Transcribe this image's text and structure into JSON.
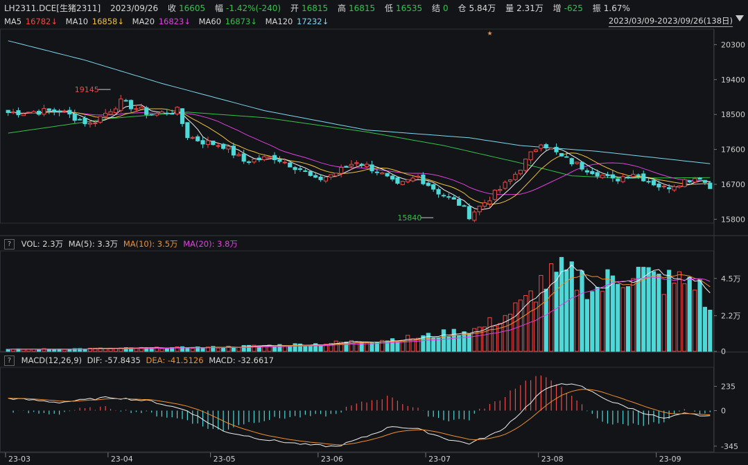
{
  "header": {
    "symbol": "LH2311.DCE[生猪2311]",
    "date": "2023/09/26",
    "close_label": "收",
    "close": "16605",
    "change_label": "幅",
    "change": "-1.42%(-240)",
    "open_label": "开",
    "open": "16815",
    "high_label": "高",
    "high": "16815",
    "low_label": "低",
    "low": "16535",
    "settle_label": "结",
    "settle": "0",
    "oi_label": "仓",
    "oi": "5.84万",
    "vol_label": "量",
    "vol": "2.31万",
    "inc_label": "增",
    "inc": "-625",
    "amp_label": "振",
    "amp": "1.67%"
  },
  "ma_bar": [
    {
      "name": "MA5",
      "value": "16782↓",
      "color": "#f0f0f0"
    },
    {
      "name": "MA10",
      "value": "16858↓",
      "color": "#f0c040"
    },
    {
      "name": "MA20",
      "value": "16823↓",
      "color": "#e040e0"
    },
    {
      "name": "MA60",
      "value": "16873↓",
      "color": "#33c44a"
    },
    {
      "name": "MA120",
      "value": "17232↓",
      "color": "#7fd8f0"
    }
  ],
  "date_range": "2023/03/09-2023/09/26(138日)",
  "vol_panel": {
    "help": "?",
    "title": "VOL: 2.3万",
    "ma5": "MA(5): 3.3万",
    "ma10": "MA(10): 3.5万",
    "ma20": "MA(20): 3.8万"
  },
  "macd_panel": {
    "help": "?",
    "title": "MACD(12,26,9)",
    "dif": "DIF: -57.8435",
    "dea": "DEA: -41.5126",
    "macd": "MACD: -32.6617"
  },
  "colors": {
    "up": "#f04a4a",
    "down": "#4fd8d8",
    "ma5": "#f0f0f0",
    "ma10": "#f0c040",
    "ma20": "#e040e0",
    "ma60": "#33c44a",
    "ma120": "#7fd8f0",
    "dea": "#f09030"
  },
  "chart_data": [
    {
      "type": "candlestick",
      "ylim": [
        15700,
        20700
      ],
      "yticks": [
        "20300",
        "19400",
        "18500",
        "17600",
        "16700",
        "15800"
      ],
      "ytick_values": [
        20300,
        19400,
        18500,
        17600,
        16700,
        15800
      ],
      "annotations": [
        {
          "text": "19145",
          "value": 19145
        },
        {
          "text": "15840",
          "value": 15840
        }
      ],
      "ma60_anchors": [
        [
          0,
          18020
        ],
        [
          20,
          18400
        ],
        [
          35,
          18560
        ],
        [
          50,
          18420
        ],
        [
          70,
          18050
        ],
        [
          85,
          17700
        ],
        [
          100,
          17250
        ],
        [
          110,
          16920
        ],
        [
          120,
          16860
        ],
        [
          137,
          16873
        ]
      ],
      "ma120_anchors": [
        [
          0,
          20400
        ],
        [
          15,
          19900
        ],
        [
          30,
          19300
        ],
        [
          50,
          18600
        ],
        [
          70,
          18100
        ],
        [
          90,
          17900
        ],
        [
          100,
          17700
        ],
        [
          115,
          17550
        ],
        [
          137,
          17232
        ]
      ]
    },
    {
      "type": "bar",
      "title": "VOL",
      "ylim": [
        0,
        62000
      ],
      "yticks": [
        "4.5万",
        "2.2万",
        "0"
      ],
      "ytick_values": [
        45000,
        22000,
        0
      ]
    },
    {
      "type": "bar",
      "title": "MACD",
      "ylim": [
        -400,
        420
      ],
      "yticks": [
        "235",
        "0",
        "-345"
      ],
      "ytick_values": [
        235,
        0,
        -345
      ]
    }
  ],
  "x_axis": [
    {
      "label": "23-03",
      "index": 0
    },
    {
      "label": "23-04",
      "index": 20
    },
    {
      "label": "23-05",
      "index": 40
    },
    {
      "label": "23-06",
      "index": 61
    },
    {
      "label": "23-07",
      "index": 82
    },
    {
      "label": "23-08",
      "index": 104
    },
    {
      "label": "23-09",
      "index": 127
    }
  ],
  "close_anchors": [
    [
      0,
      18550
    ],
    [
      10,
      18600
    ],
    [
      16,
      18250
    ],
    [
      22,
      18820
    ],
    [
      28,
      18500
    ],
    [
      33,
      18600
    ],
    [
      35,
      17950
    ],
    [
      38,
      17800
    ],
    [
      42,
      17700
    ],
    [
      46,
      17300
    ],
    [
      52,
      17400
    ],
    [
      57,
      17100
    ],
    [
      60,
      16800
    ],
    [
      64,
      17000
    ],
    [
      68,
      17300
    ],
    [
      72,
      17050
    ],
    [
      76,
      16650
    ],
    [
      80,
      16900
    ],
    [
      84,
      16500
    ],
    [
      88,
      16200
    ],
    [
      90,
      15900
    ],
    [
      94,
      16350
    ],
    [
      98,
      16800
    ],
    [
      101,
      17300
    ],
    [
      104,
      17800
    ],
    [
      108,
      17400
    ],
    [
      112,
      17150
    ],
    [
      115,
      17000
    ],
    [
      118,
      16800
    ],
    [
      122,
      17000
    ],
    [
      125,
      16800
    ],
    [
      128,
      16600
    ],
    [
      132,
      16800
    ],
    [
      135,
      16900
    ],
    [
      137,
      16605
    ]
  ],
  "vol_anchors": [
    [
      0,
      1200
    ],
    [
      20,
      1800
    ],
    [
      40,
      2500
    ],
    [
      60,
      4500
    ],
    [
      80,
      8500
    ],
    [
      92,
      14000
    ],
    [
      97,
      22000
    ],
    [
      101,
      30000
    ],
    [
      104,
      42000
    ],
    [
      108,
      47000
    ],
    [
      112,
      44000
    ],
    [
      115,
      38000
    ],
    [
      118,
      45000
    ],
    [
      122,
      50000
    ],
    [
      126,
      44000
    ],
    [
      130,
      42000
    ],
    [
      134,
      45000
    ],
    [
      137,
      23100
    ]
  ],
  "dif_anchors": [
    [
      0,
      120
    ],
    [
      10,
      80
    ],
    [
      20,
      130
    ],
    [
      28,
      90
    ],
    [
      35,
      0
    ],
    [
      42,
      -200
    ],
    [
      50,
      -280
    ],
    [
      58,
      -330
    ],
    [
      64,
      -350
    ],
    [
      70,
      -250
    ],
    [
      75,
      -150
    ],
    [
      80,
      -180
    ],
    [
      86,
      -280
    ],
    [
      90,
      -320
    ],
    [
      96,
      -200
    ],
    [
      100,
      -20
    ],
    [
      104,
      180
    ],
    [
      108,
      270
    ],
    [
      112,
      230
    ],
    [
      118,
      80
    ],
    [
      124,
      -20
    ],
    [
      128,
      -80
    ],
    [
      132,
      -30
    ],
    [
      137,
      -58
    ]
  ]
}
